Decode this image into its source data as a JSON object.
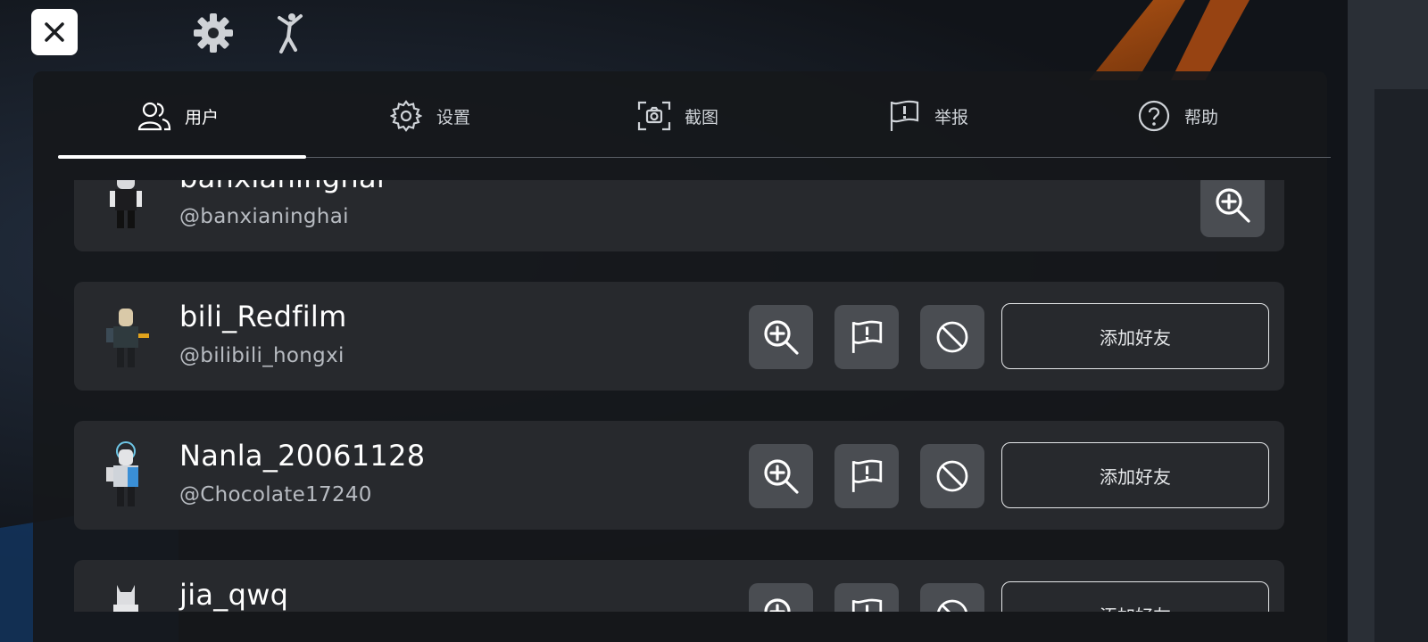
{
  "window": {
    "close_label": "close"
  },
  "top_icons": [
    "gear-icon",
    "emote-icon"
  ],
  "tabs": [
    {
      "label": "用户",
      "icon": "users-icon",
      "active": true
    },
    {
      "label": "设置",
      "icon": "gear-icon",
      "active": false
    },
    {
      "label": "截图",
      "icon": "screenshot-icon",
      "active": false
    },
    {
      "label": "举报",
      "icon": "flag-icon",
      "active": false
    },
    {
      "label": "帮助",
      "icon": "help-icon",
      "active": false
    }
  ],
  "players": [
    {
      "name": "banxianinghai",
      "handle": "@banxianinghai",
      "add_friend_label": ""
    },
    {
      "name": "bili_Redfilm",
      "handle": "@bilibili_hongxi",
      "add_friend_label": "添加好友"
    },
    {
      "name": "Nanla_20061128",
      "handle": "@Chocolate17240",
      "add_friend_label": "添加好友"
    },
    {
      "name": "jia_qwq",
      "handle": "",
      "add_friend_label": "添加好友"
    }
  ],
  "colors": {
    "panel": "#16181b",
    "row": "#27292d",
    "icon_button": "#4a4d52",
    "accent": "#ffffff"
  }
}
